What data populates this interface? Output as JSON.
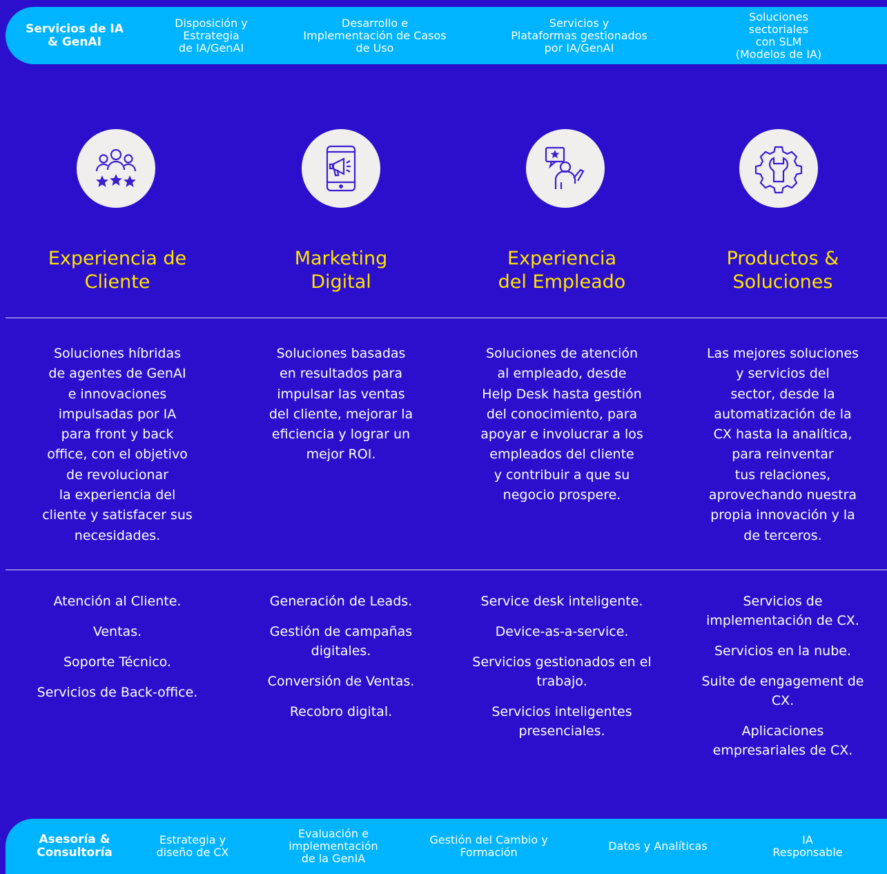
{
  "top_bar": {
    "lead": "Servicios de IA\n& GenAI",
    "items": [
      "Disposición y\nEstrategia\nde IA/GenAI",
      "Desarrollo e\nImplementación de Casos\nde Uso",
      "Servicios y\nPlataformas gestionados\npor IA/GenAI",
      "Soluciones sectoriales\ncon SLM\n(Modelos de IA)"
    ]
  },
  "columns": [
    {
      "icon": "customer-rating-icon",
      "title": "Experiencia de\nCliente",
      "description": "Soluciones híbridas\nde agentes de GenAI\ne innovaciones\nimpulsadas por IA\npara front y back\noffice, con el objetivo\nde revolucionar\nla experiencia del\ncliente y satisfacer sus\nnecesidades.",
      "services": [
        "Atención al Cliente.",
        "Ventas.",
        "Soporte Técnico.",
        "Servicios de Back-office."
      ]
    },
    {
      "icon": "tablet-megaphone-icon",
      "title": "Marketing\nDigital",
      "description": "Soluciones basadas\nen resultados para\nimpulsar las ventas\ndel cliente, mejorar la\neficiencia y lograr un\nmejor ROI.",
      "services": [
        "Generación de Leads.",
        "Gestión de campañas\ndigitales.",
        "Conversión de Ventas.",
        "Recobro digital."
      ]
    },
    {
      "icon": "employee-presentation-icon",
      "title": "Experiencia\ndel Empleado",
      "description": "Soluciones de atención\nal empleado, desde\nHelp Desk hasta gestión\ndel conocimiento, para\napoyar e involucrar a los\nempleados del cliente\ny contribuir a que su\nnegocio prospere.",
      "services": [
        "Service desk inteligente.",
        "Device-as-a-service.",
        "Servicios gestionados en el\ntrabajo.",
        "Servicios inteligentes\npresenciales."
      ]
    },
    {
      "icon": "gear-wrench-icon",
      "title": "Productos &\nSoluciones",
      "description": "Las mejores soluciones\ny servicios del\nsector, desde la\nautomatización de la\nCX hasta la analítica,\npara reinventar\ntus relaciones,\naprovechando nuestra\npropia innovación y la\nde terceros.",
      "services": [
        "Servicios de\nimplementación de CX.",
        "Servicios en la nube.",
        "Suite de engagement de\nCX.",
        "Aplicaciones\nempresariales de CX."
      ]
    }
  ],
  "bottom_bar": {
    "lead": "Asesoría &\nConsultoría",
    "items": [
      "Estrategia y\ndiseño de CX",
      "Evaluación e\nimplementación\nde la GenIA",
      "Gestión del Cambio y\nFormación",
      "Datos y Analíticas",
      "IA Responsable"
    ]
  },
  "colors": {
    "background": "#2C0FCC",
    "bar": "#00B4FF",
    "title": "#FFE500",
    "icon_bg": "#F1EFEE",
    "icon_stroke": "#3A1FD0"
  }
}
